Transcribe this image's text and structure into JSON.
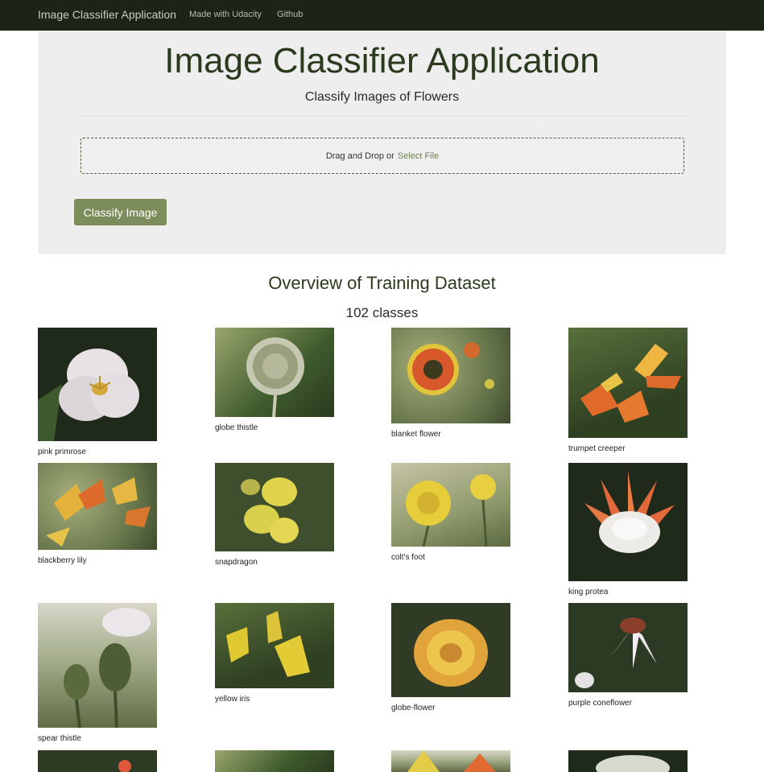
{
  "navbar": {
    "brand": "Image Classifier Application",
    "links": [
      "Made with Udacity",
      "Github"
    ]
  },
  "jumbotron": {
    "title": "Image Classifier Application",
    "subtitle": "Classify Images of Flowers",
    "dropzone_text": "Drag and Drop or",
    "dropzone_link": "Select File",
    "classify_button": "Classify Image"
  },
  "overview": {
    "title": "Overview of Training Dataset",
    "count": "102 classes"
  },
  "gallery": {
    "items": [
      {
        "label": "pink primrose"
      },
      {
        "label": "globe thistle"
      },
      {
        "label": "blanket flower"
      },
      {
        "label": "trumpet creeper"
      },
      {
        "label": "blackberry lily"
      },
      {
        "label": "snapdragon"
      },
      {
        "label": "colt's foot"
      },
      {
        "label": "king protea"
      },
      {
        "label": "spear thistle"
      },
      {
        "label": "yellow iris"
      },
      {
        "label": "globe-flower"
      },
      {
        "label": "purple coneflower"
      }
    ]
  },
  "colors": {
    "navbar_bg": "#1c2418",
    "accent": "#7d8c5b",
    "heading": "#2b3a1c"
  }
}
